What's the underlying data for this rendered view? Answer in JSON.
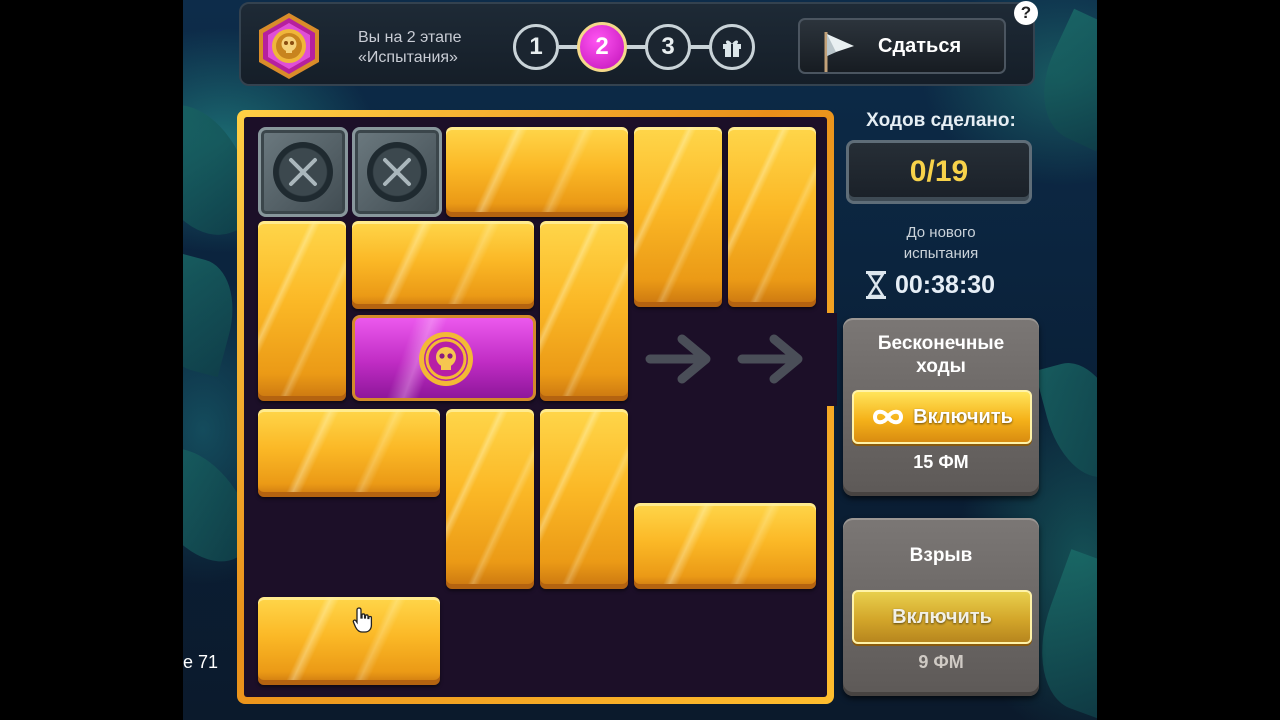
{
  "colors": {
    "accent_pink": "#e33be6",
    "gold": "#f5b21a",
    "moves_text": "#f7d24a"
  },
  "header": {
    "stage_line1": "Вы на 2 этапе",
    "stage_line2": "«Испытания»",
    "steps": [
      "1",
      "2",
      "3"
    ],
    "active_step": "2",
    "gift_icon": "gift-icon",
    "surrender_label": "Сдаться",
    "help_label": "?"
  },
  "side_panel": {
    "moves_label": "Ходов сделано:",
    "moves_value": "0/19",
    "next_line1": "До нового",
    "next_line2": "испытания",
    "timer": "00:38:30",
    "infinite": {
      "title_line1": "Бесконечные",
      "title_line2": "ходы",
      "button": "Включить",
      "price": "15 ФМ"
    },
    "explosion": {
      "title": "Взрыв",
      "button": "Включить",
      "price": "9 ФМ"
    }
  },
  "page": {
    "side_label": "e 71"
  }
}
